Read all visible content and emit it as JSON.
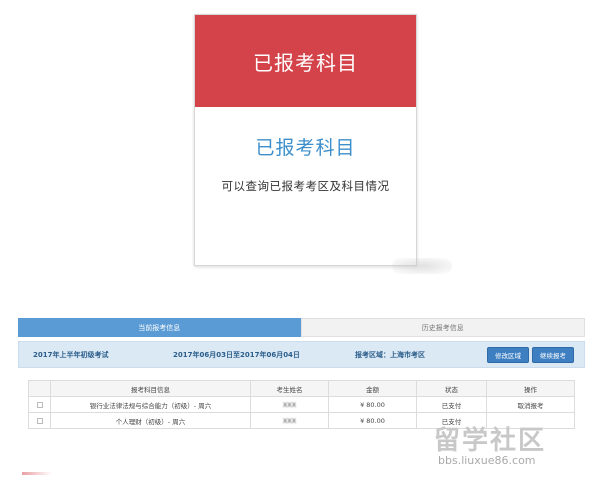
{
  "card": {
    "header": "已报考科目",
    "title": "已报考科目",
    "description": "可以查询已报考考区及科目情况"
  },
  "tabs": [
    {
      "label": "当前报考信息",
      "active": true
    },
    {
      "label": "历史报考信息",
      "active": false
    }
  ],
  "exam": {
    "name": "2017年上半年初级考试",
    "dates": "2017年06月03日至2017年06月04日",
    "region": "报考区域：上海市考区",
    "modify_label": "修改区域",
    "continue_label": "继续报考"
  },
  "table": {
    "headers": [
      "",
      "报考科目信息",
      "考生姓名",
      "金额",
      "状态",
      "操作"
    ],
    "rows": [
      {
        "subject": "银行业法律法规与综合能力（初级）- 周六",
        "name": "XXX",
        "amount": "¥ 80.00",
        "status": "已支付",
        "action": "取消报考"
      },
      {
        "subject": "个人理财（初级）- 周六",
        "name": "XXX",
        "amount": "¥ 80.00",
        "status": "已支付",
        "action": ""
      }
    ]
  },
  "watermark": {
    "text": "留学社区",
    "url": "bbs.liuxue86.com"
  },
  "colors": {
    "card_header": "#d4424a",
    "accent_blue": "#3d8fcc",
    "tab_active": "#5b9bd5",
    "button": "#3d7fc1"
  }
}
